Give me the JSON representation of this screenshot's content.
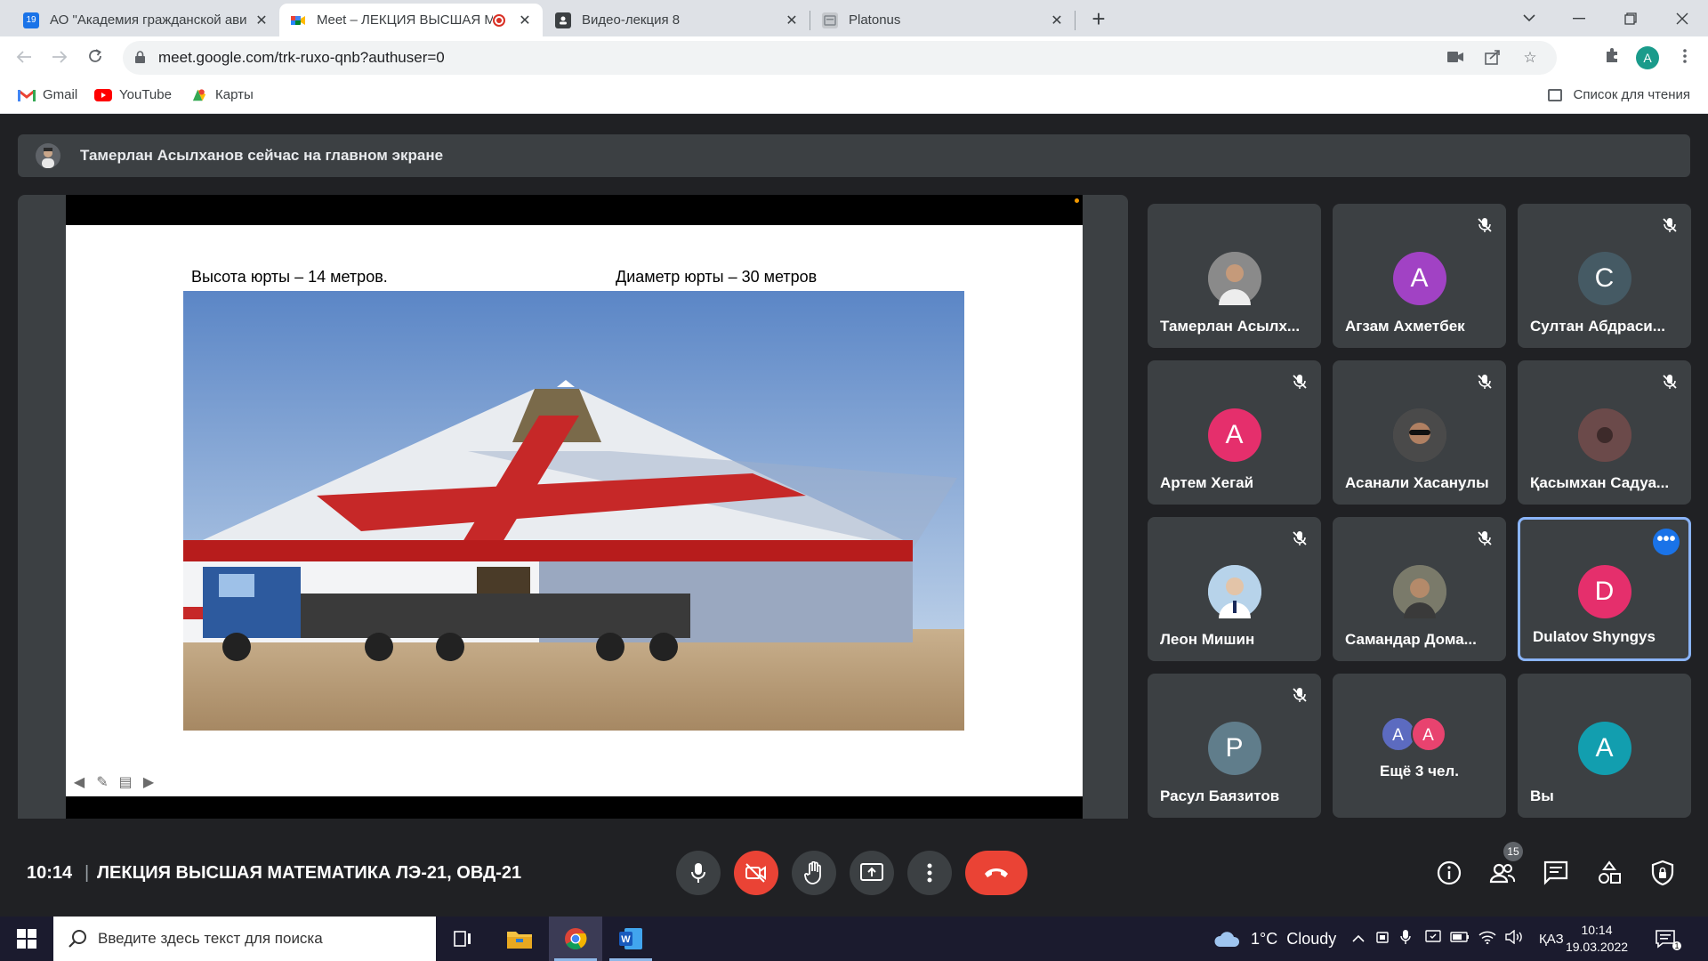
{
  "browser": {
    "tabs": [
      {
        "label": "АО \"Академия гражданской ави",
        "favicon": "calendar-19",
        "favicon_color": "#1a73e8"
      },
      {
        "label": "Meet – ЛЕКЦИЯ ВЫСШАЯ М",
        "favicon": "meet",
        "recording": true
      },
      {
        "label": "Видео-лекция 8",
        "favicon": "classroom"
      },
      {
        "label": "Platonus",
        "favicon": "page"
      }
    ],
    "url": "meet.google.com/trk-ruxo-qnb?authuser=0",
    "profile_initial": "A",
    "bookmarks": [
      {
        "label": "Gmail",
        "icon": "gmail-icon"
      },
      {
        "label": "YouTube",
        "icon": "youtube-icon"
      },
      {
        "label": "Карты",
        "icon": "maps-icon"
      }
    ],
    "reading_list": "Список для чтения"
  },
  "meet": {
    "presenter_banner": "Тамерлан Асылханов сейчас на главном экране",
    "slide": {
      "caption_left": "Высота юрты – 14 метров.",
      "caption_right": "Диаметр юрты – 30 метров"
    },
    "participants": [
      {
        "name": "Тамерлан Асылх...",
        "type": "photo",
        "muted": false
      },
      {
        "name": "Агзам Ахметбек",
        "initial": "А",
        "color": "#a142c4",
        "muted": true
      },
      {
        "name": "Султан Абдраси...",
        "initial": "С",
        "color": "#455a64",
        "muted": true
      },
      {
        "name": "Артем Хегай",
        "initial": "А",
        "color": "#e52f6c",
        "muted": true
      },
      {
        "name": "Асанали Хасанулы",
        "type": "photo",
        "muted": true
      },
      {
        "name": "Қасымхан Садуа...",
        "type": "photo",
        "muted": true
      },
      {
        "name": "Леон Мишин",
        "type": "photo",
        "muted": true
      },
      {
        "name": "Самандар Дома...",
        "type": "photo",
        "muted": true
      },
      {
        "name": "Dulatov Shyngys",
        "initial": "D",
        "color": "#e52f6c",
        "muted": false,
        "speaking": true
      },
      {
        "name": "Расул Баязитов",
        "initial": "Р",
        "color": "#607d8b",
        "muted": true
      },
      {
        "others_label": "Ещё 3 чел.",
        "initials": [
          "А",
          "А"
        ],
        "colors": [
          "#5c6bc0",
          "#e8436f"
        ]
      },
      {
        "name": "Вы",
        "initial": "А",
        "color": "#129eaf",
        "muted": false
      }
    ],
    "time": "10:14",
    "separator": "|",
    "meeting_title": "ЛЕКЦИЯ ВЫСШАЯ МАТЕМАТИКА ЛЭ-21, ОВД-21",
    "participant_count": "15"
  },
  "taskbar": {
    "search_placeholder": "Введите здесь текст для поиска",
    "weather": "1°C  Cloudy",
    "language": "ҚАЗ",
    "time": "10:14",
    "date": "19.03.2022"
  }
}
